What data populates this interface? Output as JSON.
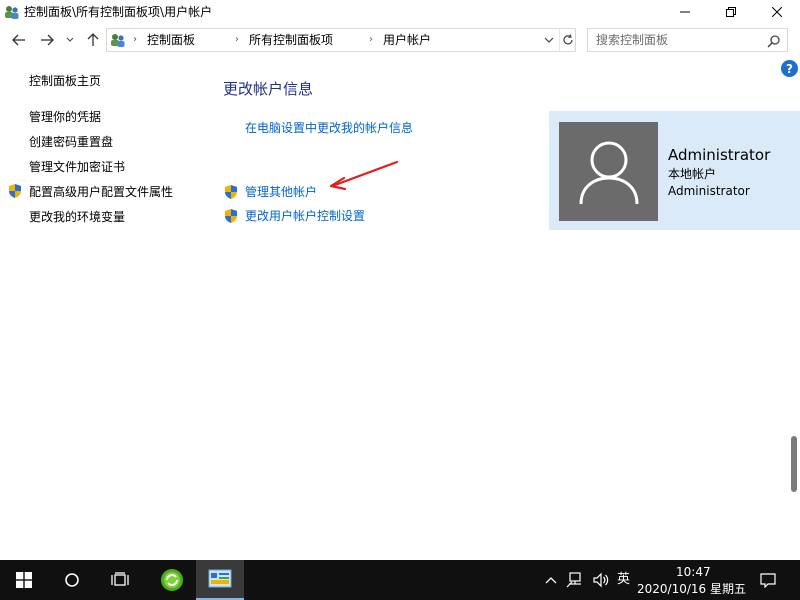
{
  "window": {
    "title": "控制面板\\所有控制面板项\\用户帐户"
  },
  "navigation": {
    "breadcrumbs": [
      "控制面板",
      "所有控制面板项",
      "用户帐户"
    ],
    "search_placeholder": "搜索控制面板"
  },
  "left_nav": {
    "items": [
      {
        "label": "控制面板主页",
        "shield": false
      },
      {
        "label": "管理你的凭据",
        "shield": false
      },
      {
        "label": "创建密码重置盘",
        "shield": false
      },
      {
        "label": "管理文件加密证书",
        "shield": false
      },
      {
        "label": "配置高级用户配置文件属性",
        "shield": true
      },
      {
        "label": "更改我的环境变量",
        "shield": false
      }
    ]
  },
  "main": {
    "title": "更改帐户信息",
    "links": [
      {
        "label": "在电脑设置中更改我的帐户信息",
        "shield": false
      },
      {
        "label": "管理其他帐户",
        "shield": true
      },
      {
        "label": "更改用户帐户控制设置",
        "shield": true
      }
    ]
  },
  "account": {
    "name": "Administrator",
    "type": "本地帐户",
    "role": "Administrator"
  },
  "taskbar": {
    "input_language": "英",
    "time": "10:47",
    "date": "2020/10/16 星期五"
  },
  "colors": {
    "link": "#0066cc",
    "title": "#1e3287",
    "card_bg": "#dbeaf9",
    "avatar_bg": "#6b6b6b",
    "annotation_arrow": "#e02020",
    "taskbar_bg": "#101010"
  }
}
